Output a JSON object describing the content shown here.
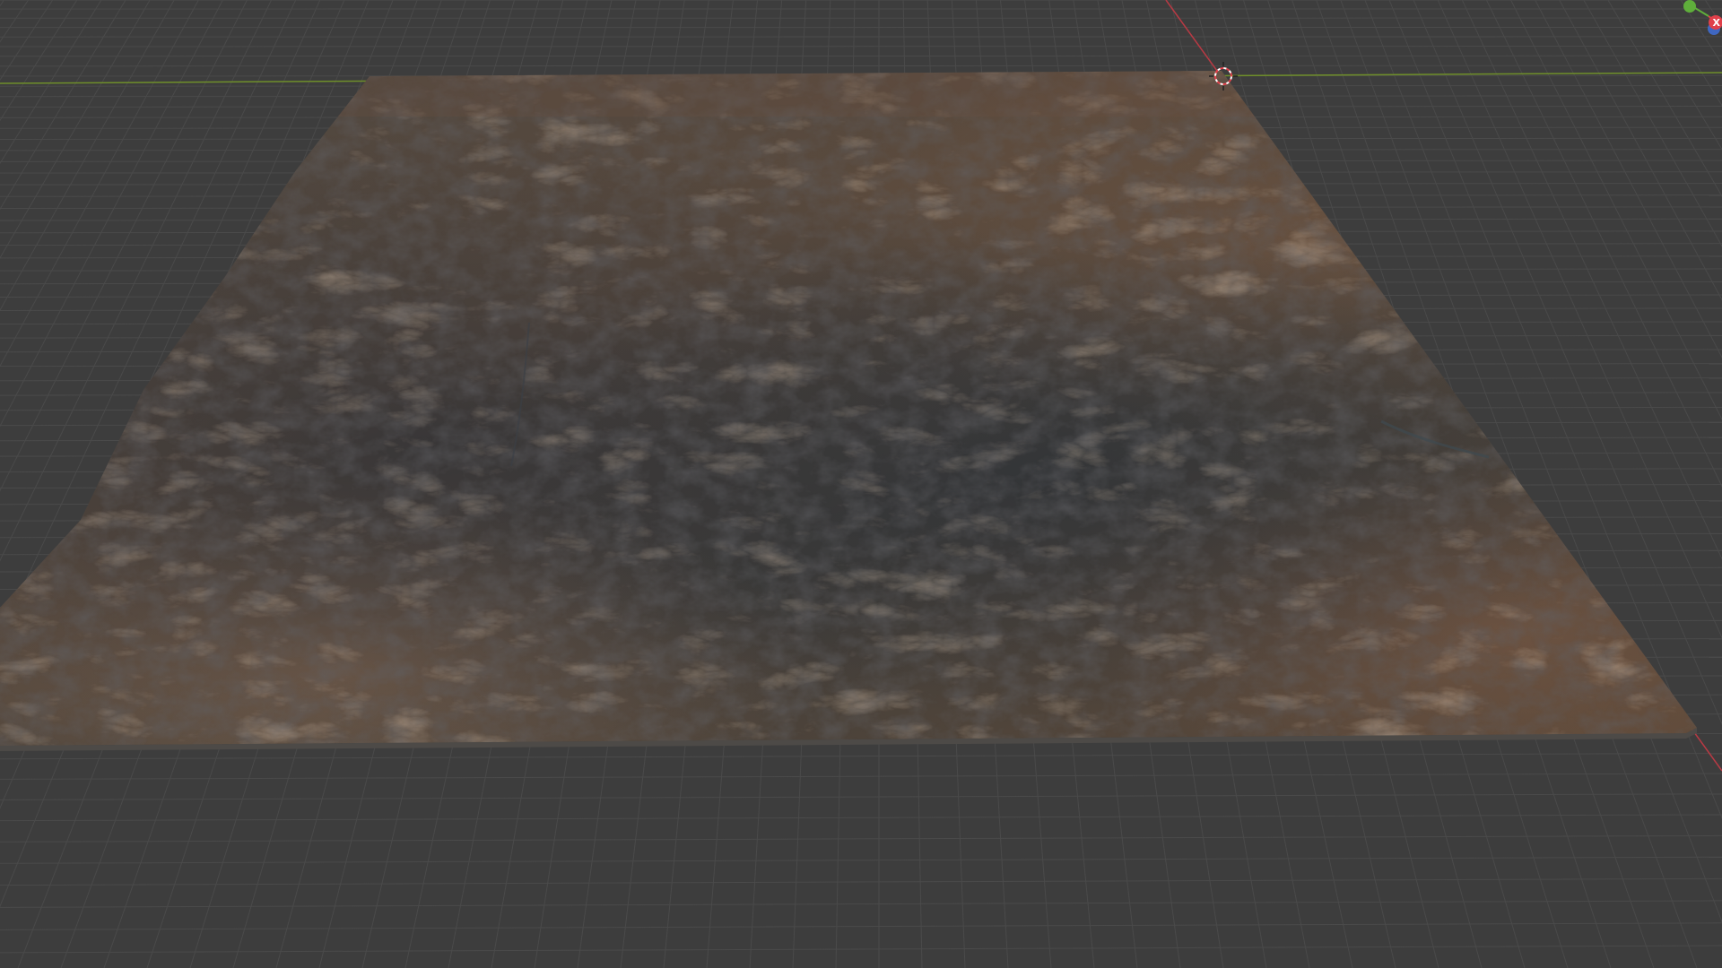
{
  "app": {
    "editor": "3D Viewport",
    "shading_mode": "material-preview"
  },
  "scene": {
    "object": "terrain-heightmap-mesh",
    "background_color": "#3d3d3d",
    "grid_color": "#4a4a4a",
    "x_axis_color": "#c63a47",
    "y_axis_color": "#7c9e2a"
  },
  "navigation_gizmo": {
    "axes": [
      {
        "axis": "x",
        "label": "X",
        "color": "#e0404a"
      },
      {
        "axis": "y",
        "label": "",
        "color": "#5fae3b"
      },
      {
        "axis": "z",
        "label": "",
        "color": "#3f6fd8"
      }
    ]
  },
  "icons": {
    "cursor": "3d-cursor-icon",
    "gizmo": "navigation-gizmo-icon"
  }
}
